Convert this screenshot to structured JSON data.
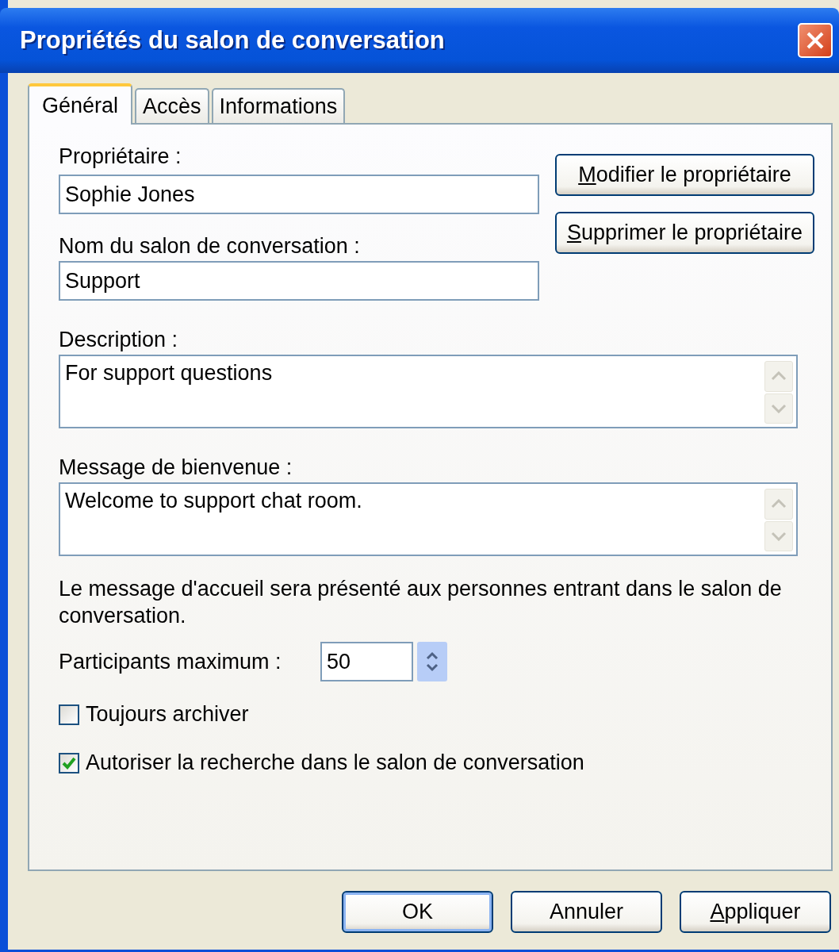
{
  "window": {
    "title": "Propriétés du salon de conversation"
  },
  "tabs": [
    {
      "label": "Général",
      "selected": true
    },
    {
      "label": "Accès",
      "selected": false
    },
    {
      "label": "Informations",
      "selected": false
    }
  ],
  "owner": {
    "label": "Propriétaire :",
    "value": "Sophie Jones"
  },
  "owner_buttons": [
    {
      "label": "Modifier le propriétaire",
      "underline_first": true
    },
    {
      "label": "Supprimer le propriétaire",
      "underline_first": true
    }
  ],
  "room_name": {
    "label": "Nom du salon de conversation :",
    "value": "Support"
  },
  "description": {
    "label": "Description :",
    "value": "For support questions"
  },
  "welcome": {
    "label": "Message de bienvenue :",
    "value": "Welcome to support chat room."
  },
  "note": "Le message d'accueil sera présenté aux personnes entrant dans le salon de conversation.",
  "max_participants": {
    "label": "Participants maximum :",
    "value": "50"
  },
  "options": [
    {
      "label": "Toujours archiver",
      "checked": false
    },
    {
      "label": "Autoriser la recherche dans le salon de conversation",
      "checked": true
    }
  ],
  "buttons": [
    {
      "label": "OK",
      "default": true,
      "underline_first": false
    },
    {
      "label": "Annuler",
      "default": false,
      "underline_first": false
    },
    {
      "label": "Appliquer",
      "default": false,
      "underline_first": true
    }
  ]
}
